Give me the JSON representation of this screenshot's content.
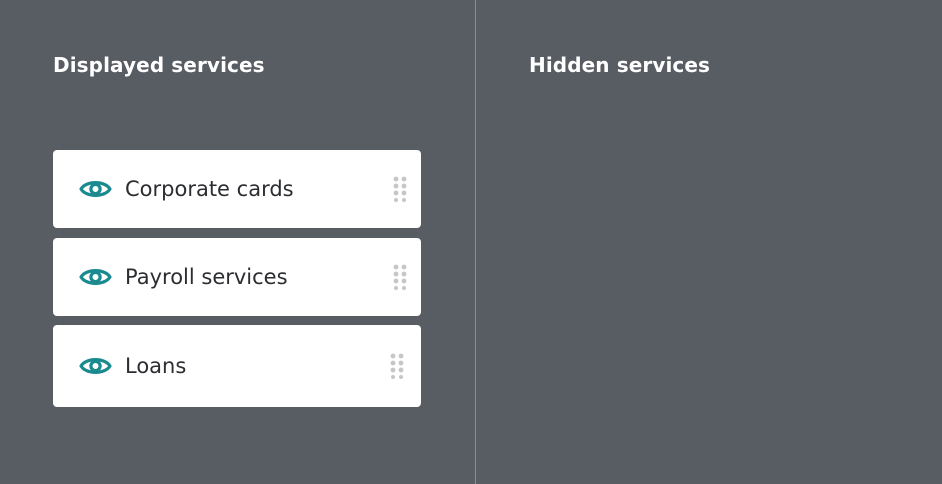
{
  "displayed_panel": {
    "title": "Displayed services",
    "services": [
      {
        "label": "Corporate cards",
        "icon": "eye-icon",
        "visible": true
      },
      {
        "label": "Payroll services",
        "icon": "eye-icon",
        "visible": true
      },
      {
        "label": "Loans",
        "icon": "eye-icon",
        "visible": true
      }
    ]
  },
  "hidden_panel": {
    "title": "Hidden services",
    "services": []
  },
  "colors": {
    "background": "#585c63",
    "card": "#ffffff",
    "accent": "#1a8a8e",
    "handle": "#c4c6ca",
    "text": "#2b2d31"
  }
}
